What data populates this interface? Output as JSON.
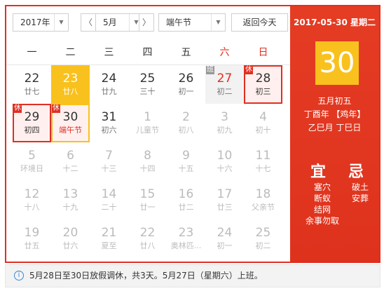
{
  "toolbar": {
    "year": "2017年",
    "prev": "〈",
    "month": "5月",
    "next": "〉",
    "holiday": "端午节",
    "today_button": "返回今天"
  },
  "weekdays": [
    "一",
    "二",
    "三",
    "四",
    "五",
    "六",
    "日"
  ],
  "days": [
    {
      "day": "22",
      "lunar": "廿七"
    },
    {
      "day": "23",
      "lunar": "廿八"
    },
    {
      "day": "24",
      "lunar": "廿九"
    },
    {
      "day": "25",
      "lunar": "三十"
    },
    {
      "day": "26",
      "lunar": "初一"
    },
    {
      "day": "27",
      "lunar": "初二",
      "tag": "班"
    },
    {
      "day": "28",
      "lunar": "初三",
      "tag": "休"
    },
    {
      "day": "29",
      "lunar": "初四",
      "tag": "休"
    },
    {
      "day": "30",
      "lunar": "端午节",
      "tag": "休"
    },
    {
      "day": "31",
      "lunar": "初六"
    },
    {
      "day": "1",
      "lunar": "儿童节"
    },
    {
      "day": "2",
      "lunar": "初八"
    },
    {
      "day": "3",
      "lunar": "初九"
    },
    {
      "day": "4",
      "lunar": "初十"
    },
    {
      "day": "5",
      "lunar": "环境日"
    },
    {
      "day": "6",
      "lunar": "十二"
    },
    {
      "day": "7",
      "lunar": "十三"
    },
    {
      "day": "8",
      "lunar": "十四"
    },
    {
      "day": "9",
      "lunar": "十五"
    },
    {
      "day": "10",
      "lunar": "十六"
    },
    {
      "day": "11",
      "lunar": "十七"
    },
    {
      "day": "12",
      "lunar": "十八"
    },
    {
      "day": "13",
      "lunar": "十九"
    },
    {
      "day": "14",
      "lunar": "二十"
    },
    {
      "day": "15",
      "lunar": "廿一"
    },
    {
      "day": "16",
      "lunar": "廿二"
    },
    {
      "day": "17",
      "lunar": "廿三"
    },
    {
      "day": "18",
      "lunar": "父亲节"
    },
    {
      "day": "19",
      "lunar": "廿五"
    },
    {
      "day": "20",
      "lunar": "廿六"
    },
    {
      "day": "21",
      "lunar": "夏至"
    },
    {
      "day": "22",
      "lunar": "廿八"
    },
    {
      "day": "23",
      "lunar": "奥林匹..."
    },
    {
      "day": "24",
      "lunar": "初一"
    },
    {
      "day": "25",
      "lunar": "初二"
    }
  ],
  "panel": {
    "date": "2017-05-30 星期二",
    "big_day": "30",
    "lunar_date": "五月初五",
    "ganzhi_year": "丁酉年 【鸡年】",
    "ganzhi_month_day": "乙巳月 丁巳日",
    "yi_title": "宜",
    "ji_title": "忌",
    "yi_items": [
      "塞穴",
      "断蚁",
      "结网",
      "余事勿取"
    ],
    "ji_items": [
      "破土",
      "安葬"
    ]
  },
  "notice": {
    "icon": "info-icon",
    "text": "5月28日至30日放假调休，共3天。5月27日（星期六）上班。"
  },
  "colors": {
    "accent": "#e02f21",
    "highlight": "#f9c11d"
  }
}
